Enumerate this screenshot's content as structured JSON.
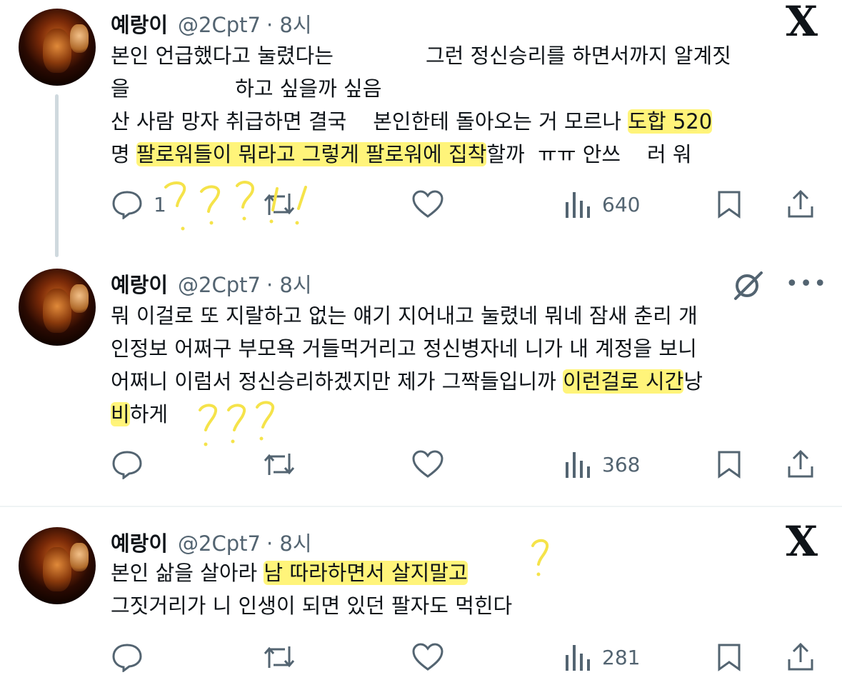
{
  "tweets": [
    {
      "name": "예랑이",
      "handle": "@2Cpt7",
      "time": "· 8시",
      "lines": [
        "본인 언급했다고 눌렸다는              그런 정신승리를 하면서까지 알계짓",
        "을                하고 싶을까 싶음",
        "산 사람 망자 취급하면 결국    본인한테 돌아오는 거 모르나 ",
        "명 "
      ],
      "hl_line3": "도합 520",
      "hl_line4": "팔로워들이 뭐라고 그렇게 팔로워에 집착",
      "line4_rest": "할까  ㅠㅠ 안쓰    러 워",
      "reply_count": "1",
      "views": "640",
      "annotation": "????!!"
    },
    {
      "name": "예랑이",
      "handle": "@2Cpt7",
      "time": "· 8시",
      "lines": [
        "뭐 이걸로 또 지랄하고 없는 얘기 지어내고 눌렸네 뭐네 잠새 춘리 개",
        "인정보 어쩌구 부모욕 거들먹거리고 정신병자네 니가 내 계정을 보니",
        "어쩌니 이럼서 정신승리하겠지만 제가 그짝들입니까 "
      ],
      "hl_line3": "이런걸로 시간",
      "line3_rest": "낭",
      "hl_line4": "비",
      "line4_rest": "하게",
      "views": "368",
      "more_label": "•••",
      "annotation": "???"
    },
    {
      "name": "예랑이",
      "handle": "@2Cpt7",
      "time": "· 8시",
      "line1": "본인 삶을 살아라 ",
      "hl_line1": "남 따라하면서 살지말고",
      "line2": "그짓거리가 니 인생이 되면 있던 팔자도 먹힌다",
      "views": "281",
      "annotation": "?"
    }
  ],
  "x_logo": "X",
  "colors": {
    "highlight": "#fff47a",
    "scribble": "#f5e34a",
    "icon": "#536471",
    "text": "#0f1419"
  },
  "icons": [
    "reply-icon",
    "retweet-icon",
    "like-icon",
    "views-icon",
    "bookmark-icon",
    "share-icon",
    "x-logo-icon",
    "grok-icon",
    "more-icon"
  ]
}
